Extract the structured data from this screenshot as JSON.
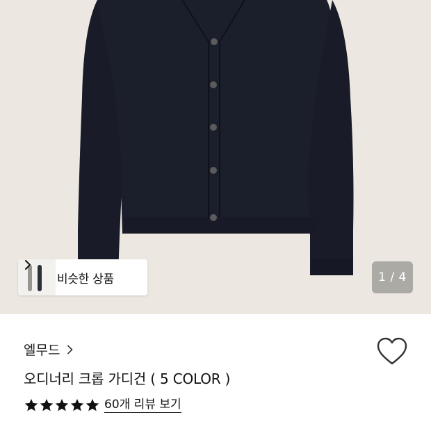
{
  "gallery": {
    "similar_products_label": "비슷한 상품",
    "counter": "1 / 4",
    "background_color": "#ece8e1",
    "product_color": "#1b1f2c"
  },
  "product": {
    "brand": "엘무드",
    "title": "오디너리 크롭 가디건 ( 5 COLOR )",
    "review_link": "60개 리뷰 보기",
    "rating_stars": 5,
    "rating_max": 5
  },
  "icons": {
    "brand_link": "chevron-right-icon",
    "wishlist": "heart-outline-icon",
    "similar": "chevron-right-icon",
    "rating": "star-icon"
  }
}
